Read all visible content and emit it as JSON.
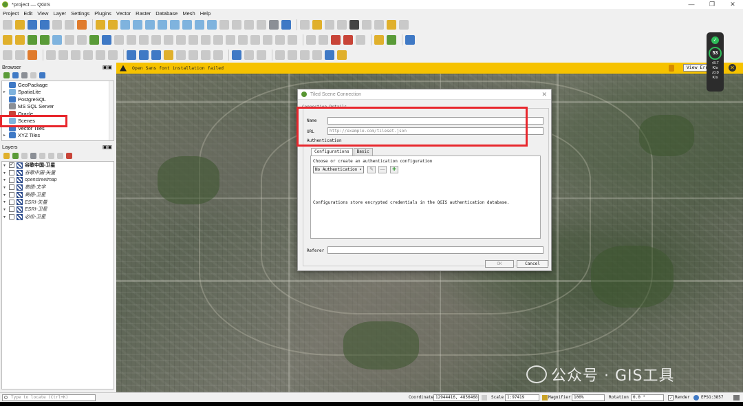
{
  "window": {
    "title": "*project — QGIS",
    "controls": [
      "—",
      "❐",
      "✕"
    ]
  },
  "menu": [
    "Project",
    "Edit",
    "View",
    "Layer",
    "Settings",
    "Plugins",
    "Vector",
    "Raster",
    "Database",
    "Mesh",
    "Help"
  ],
  "browser": {
    "title": "Browser",
    "items": [
      {
        "label": "GeoPackage",
        "icon": "geopackage-icon"
      },
      {
        "label": "SpatiaLite",
        "icon": "spatialite-icon"
      },
      {
        "label": "PostgreSQL",
        "icon": "postgresql-icon"
      },
      {
        "label": "MS SQL Server",
        "icon": "mssql-icon"
      },
      {
        "label": "Oracle",
        "icon": "oracle-icon"
      },
      {
        "label": "Scenes",
        "icon": "scenes-icon"
      },
      {
        "label": "Vector Tiles",
        "icon": "vector-tiles-icon"
      },
      {
        "label": "XYZ Tiles",
        "icon": "xyz-tiles-icon"
      }
    ]
  },
  "layers": {
    "title": "Layers",
    "items": [
      {
        "label": "谷歌中国-卫星",
        "checked": true,
        "style": "bold"
      },
      {
        "label": "谷歌中国-矢量",
        "checked": false,
        "style": "italic"
      },
      {
        "label": "openstreetmap",
        "checked": false,
        "style": "italic"
      },
      {
        "label": "高德-文字",
        "checked": false,
        "style": "italic"
      },
      {
        "label": "高德-卫星",
        "checked": false,
        "style": "italic"
      },
      {
        "label": "ESRI-矢量",
        "checked": false,
        "style": "italic"
      },
      {
        "label": "ESRI-卫星",
        "checked": false,
        "style": "italic"
      },
      {
        "label": "必应-卫星",
        "checked": false,
        "style": "italic"
      }
    ]
  },
  "message_bar": {
    "text": "Open Sans font installation failed",
    "button": "View Error",
    "close": "✕"
  },
  "net_widget": {
    "percent": "53",
    "up": "↑8.7",
    "up_unit": "K/s",
    "down": "↓0.0",
    "down_unit": "K/s"
  },
  "dialog": {
    "title": "Tiled Scene Connection",
    "group_title": "Connection Details",
    "name_label": "Name",
    "name_value": "",
    "url_label": "URL",
    "url_placeholder": "http://example.com/tileset.json",
    "auth_label": "Authentication",
    "tabs": [
      "Configurations",
      "Basic"
    ],
    "auth_hint": "Choose or create an authentication configuration",
    "auth_select": "No Authentication",
    "auth_note": "Configurations store encrypted credentials in the QGIS authentication database.",
    "referer_label": "Referer",
    "referer_value": "",
    "ok": "OK",
    "cancel": "Cancel"
  },
  "status": {
    "locate_placeholder": "Type to locate (Ctrl+K)",
    "coordinate_label": "Coordinate",
    "coordinate_value": "12944416, 4856468",
    "scale_label": "Scale",
    "scale_value": "1:97419",
    "magnifier_label": "Magnifier",
    "magnifier_value": "100%",
    "rotation_label": "Rotation",
    "rotation_value": "0.0 °",
    "render_label": "Render",
    "crs": "EPSG:3857"
  },
  "watermark": "公众号 · GIS工具"
}
